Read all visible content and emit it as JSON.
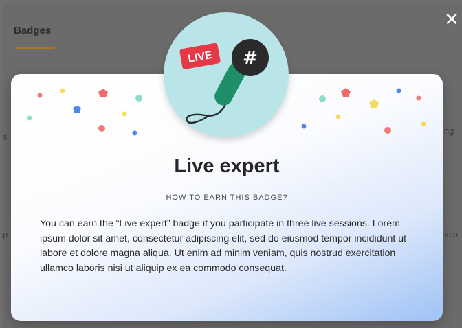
{
  "header": {
    "tab_label": "Badges",
    "close_glyph": "✕"
  },
  "background_peek": {
    "left_top": "s",
    "left_bottom": "p",
    "right_top": "ing",
    "right_bottom": "ticip"
  },
  "badge": {
    "icon": "microphone-icon",
    "live_label": "LIVE",
    "hash_glyph": "#",
    "title": "Live expert",
    "subtitle": "HOW TO EARN THIS BADGE?",
    "description": "You can earn the “Live expert” badge if you participate in three live sessions. Lorem ipsum dolor sit amet, consectetur adipiscing elit, sed do eiusmod tempor incididunt ut labore et dolore magna aliqua. Ut enim ad minim veniam, quis nostrud exercitation ullamco laboris nisi ut aliquip ex ea commodo consequat."
  },
  "colors": {
    "badge_bg": "#b9e5e9",
    "live_tag": "#e63946",
    "mic_handle": "#1f8f67",
    "mic_head": "#2a2a2a",
    "tab_accent": "#a87a16"
  }
}
